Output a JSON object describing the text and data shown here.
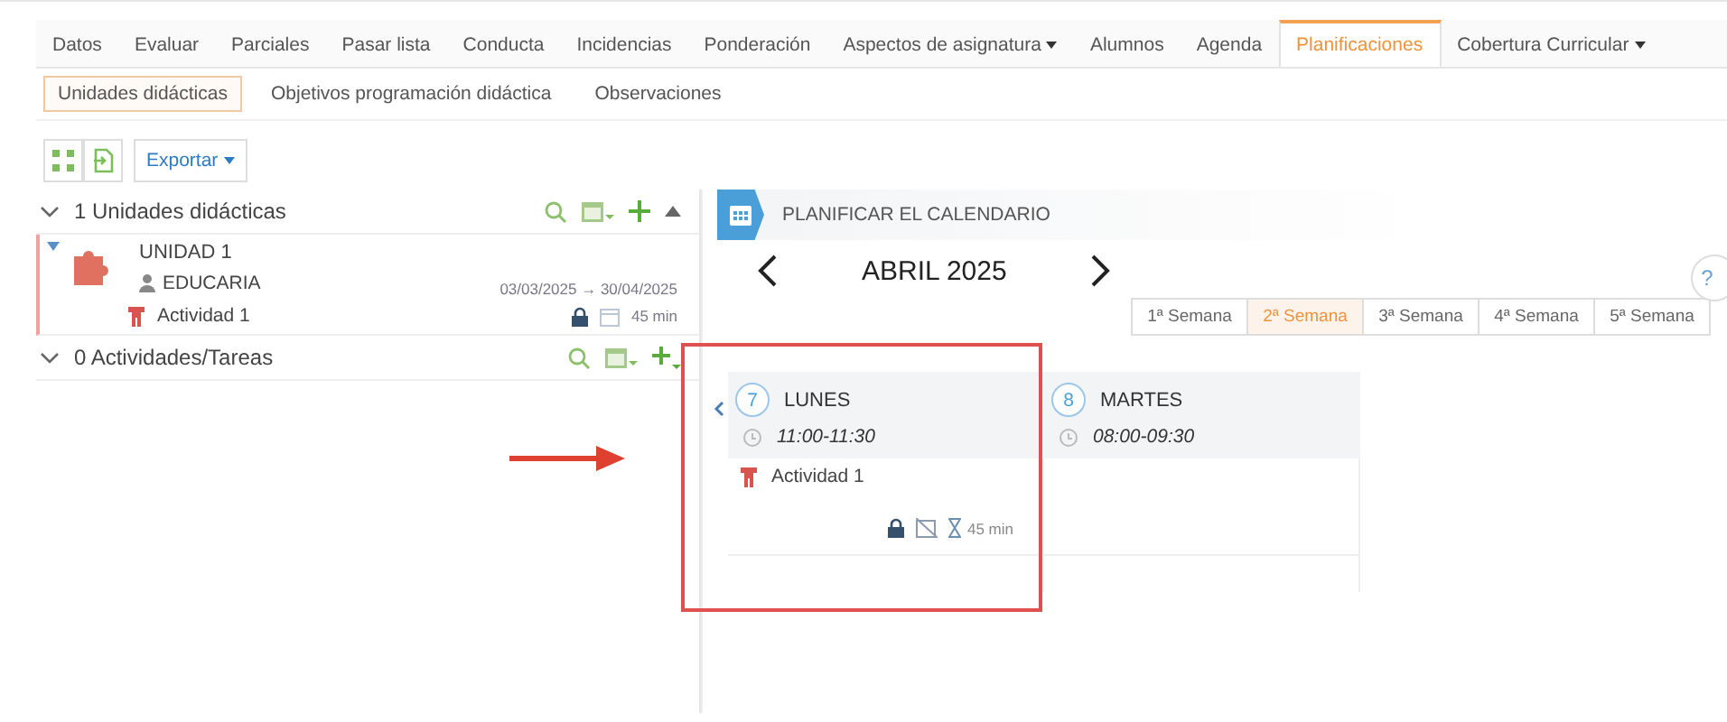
{
  "tabs": [
    {
      "label": "Datos",
      "selected": false,
      "dropdown": false
    },
    {
      "label": "Evaluar",
      "selected": false,
      "dropdown": false
    },
    {
      "label": "Parciales",
      "selected": false,
      "dropdown": false
    },
    {
      "label": "Pasar lista",
      "selected": false,
      "dropdown": false
    },
    {
      "label": "Conducta",
      "selected": false,
      "dropdown": false
    },
    {
      "label": "Incidencias",
      "selected": false,
      "dropdown": false
    },
    {
      "label": "Ponderación",
      "selected": false,
      "dropdown": false
    },
    {
      "label": "Aspectos de asignatura",
      "selected": false,
      "dropdown": true
    },
    {
      "label": "Alumnos",
      "selected": false,
      "dropdown": false
    },
    {
      "label": "Agenda",
      "selected": false,
      "dropdown": false
    },
    {
      "label": "Planificaciones",
      "selected": true,
      "dropdown": false
    },
    {
      "label": "Cobertura Curricular",
      "selected": false,
      "dropdown": true
    }
  ],
  "subtabs": [
    {
      "label": "Unidades didácticas",
      "selected": true
    },
    {
      "label": "Objetivos programación didáctica",
      "selected": false
    },
    {
      "label": "Observaciones",
      "selected": false
    }
  ],
  "toolbar": {
    "export_button": "Exportar"
  },
  "units_section": {
    "title": "1 Unidades didácticas",
    "expanded": true,
    "units": [
      {
        "name": "UNIDAD 1",
        "author": "EDUCARIA",
        "dates": "03/03/2025 → 30/04/2025",
        "activity": "Actividad 1",
        "duration": "45 min"
      }
    ]
  },
  "tasks_section": {
    "title": "0 Actividades/Tareas",
    "expanded": true
  },
  "calendar": {
    "header": "PLANIFICAR EL CALENDARIO",
    "month": "ABRIL 2025",
    "help": "?",
    "weeks": [
      {
        "label": "1ª Semana",
        "selected": false
      },
      {
        "label": "2ª Semana",
        "selected": true
      },
      {
        "label": "3ª Semana",
        "selected": false
      },
      {
        "label": "4ª Semana",
        "selected": false
      },
      {
        "label": "5ª Semana",
        "selected": false
      }
    ],
    "days": [
      {
        "number": "7",
        "name": "LUNES",
        "time": "11:00-11:30",
        "activities": [
          {
            "name": "Actividad 1",
            "duration": "45 min"
          }
        ]
      },
      {
        "number": "8",
        "name": "MARTES",
        "time": "08:00-09:30"
      }
    ]
  }
}
